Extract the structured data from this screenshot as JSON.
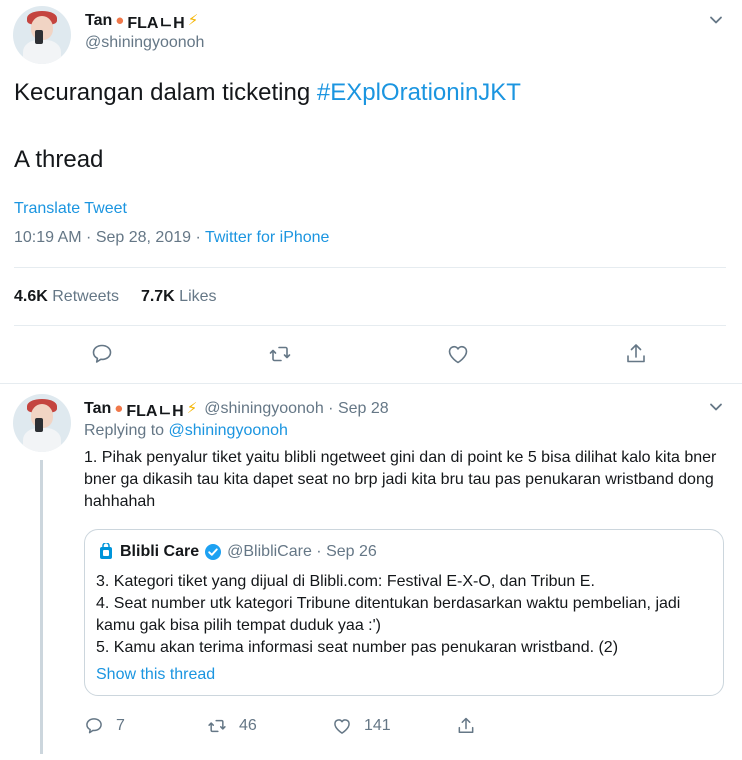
{
  "main_tweet": {
    "author": {
      "name": "Tan",
      "name_suffix": "FLA",
      "name_hangul": "ㄴ",
      "name_end": "H",
      "handle": "@shiningyoonoh"
    },
    "text_line1": "Kecurangan dalam ticketing ",
    "hashtag": "#EXplOrationinJKT",
    "text_line2": "A thread",
    "translate_label": "Translate Tweet",
    "timestamp": "10:19 AM · Sep 28, 2019 · ",
    "source": "Twitter for iPhone",
    "retweets_count": "4.6K",
    "retweets_label": " Retweets",
    "likes_count": "7.7K",
    "likes_label": " Likes"
  },
  "reply_tweet": {
    "author_name": "Tan",
    "name_suffix": "FLA",
    "name_hangul": "ㄴ",
    "name_end": "H",
    "handle_date": "@shiningyoonoh · Sep 28",
    "replying_prefix": "Replying to ",
    "replying_handle": "@shiningyoonoh",
    "text": "1. Pihak penyalur tiket yaitu blibli ngetweet gini dan di point ke 5 bisa dilihat kalo kita bner bner ga dikasih tau kita dapet seat no brp jadi kita bru tau pas penukaran wristband dong hahhahah",
    "quote": {
      "name": "Blibli Care",
      "handle_date": "@BlibliCare · Sep 26",
      "lines": [
        "3. Kategori tiket yang dijual di Blibli.com: Festival E-X-O, dan Tribun E.",
        "4. Seat number utk kategori Tribune ditentukan berdasarkan waktu pembelian, jadi kamu gak bisa pilih tempat duduk yaa :')",
        "5. Kamu akan terima informasi seat number pas penukaran wristband. (2)"
      ],
      "show_thread": "Show this thread"
    },
    "actions": {
      "reply_count": "7",
      "retweet_count": "46",
      "like_count": "141"
    }
  },
  "icons": {
    "peach": "peach-emoji",
    "bolt": "high-voltage-emoji",
    "chevron": "chevron-down-icon",
    "reply": "reply-icon",
    "retweet": "retweet-icon",
    "like": "heart-icon",
    "share": "share-icon",
    "verified": "verified-badge-icon",
    "blibli": "blibli-logo-icon"
  },
  "colors": {
    "link": "#1b95e0",
    "muted": "#657786",
    "text": "#14171a",
    "border": "#e6ecf0",
    "verified": "#1da1f2"
  }
}
